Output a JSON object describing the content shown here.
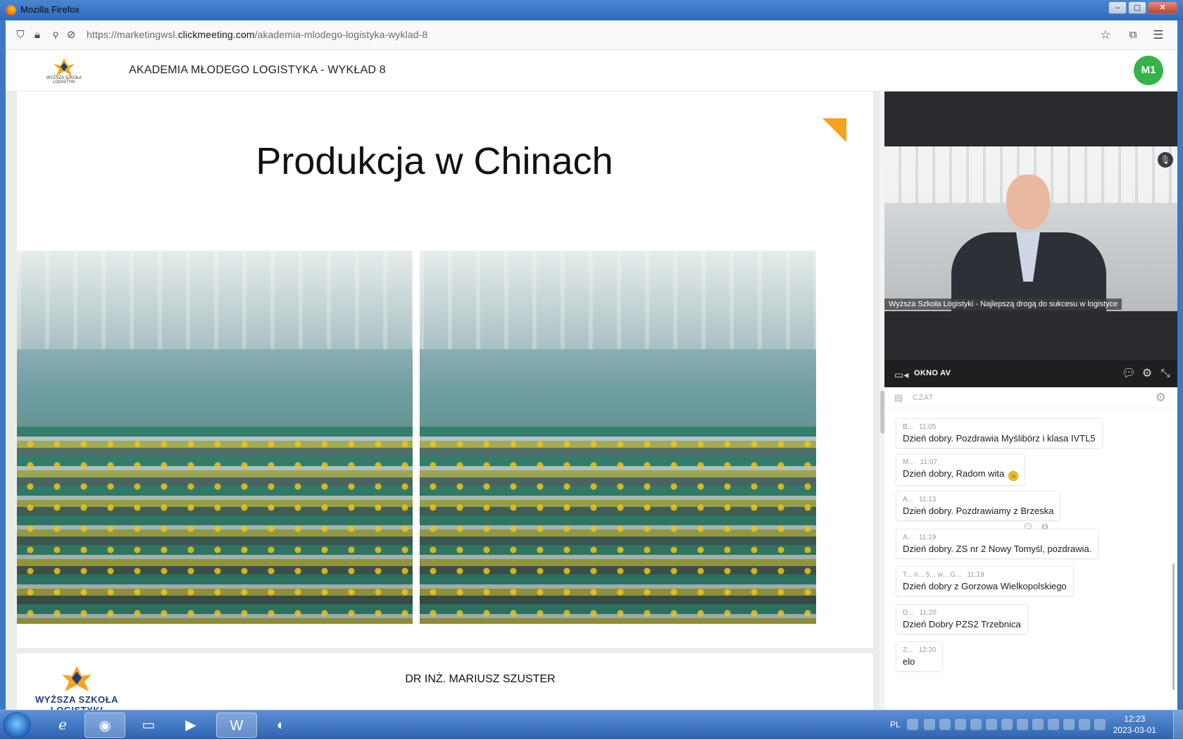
{
  "window": {
    "title": "Mozilla Firefox",
    "controls": [
      "–",
      "▢",
      "✕"
    ]
  },
  "browser": {
    "url_host_prefix": "https://marketingwsl.",
    "url_host_domain": "clickmeeting.com",
    "url_path": "/akademia-mlodego-logistyka-wyklad-8",
    "icons": [
      "shield-icon",
      "lock-icon",
      "permissions-icon",
      "tracking-icon",
      "star-icon",
      "extensions-icon",
      "menu-icon"
    ]
  },
  "header": {
    "logo_text": "WYŻSZA SZKOŁA LOGISTYKI",
    "title": "AKADEMIA MŁODEGO LOGISTYKA - WYKŁAD 8",
    "avatar": "M1"
  },
  "slide": {
    "title": "Produkcja w Chinach",
    "footer_logo_text": "WYŻSZA SZKOŁA LOGISTYKI",
    "author": "DR INŻ. MARIUSZ SZUSTER",
    "accent_color": "#f6a21e"
  },
  "av": {
    "caption": "Wyższa Szkoła Logistyki - Najlepszą drogą do sukcesu w logistyce",
    "label": "OKNO AV"
  },
  "chat": {
    "label": "CZAT",
    "messages": [
      {
        "author": "B...",
        "time": "11:05",
        "text": "Dzień dobry. Pozdrawia Myślibórz i klasa IVTL5"
      },
      {
        "author": "M...",
        "time": "11:07",
        "text": "Dzień dobry, Radom wita"
      },
      {
        "author": "A...",
        "time": "11:13",
        "text": "Dzień dobry. Pozdrawiamy z Brzeska"
      },
      {
        "author": "A...",
        "time": "11:19",
        "text": "Dzień dobry. ZS nr 2 Nowy Tomyśl, pozdrawia."
      },
      {
        "author": "T... n... 5... w... G...",
        "time": "11:19",
        "text": "Dzień dobry z Gorzowa Wielkopolskiego"
      },
      {
        "author": "D...",
        "time": "11:20",
        "text": "Dzień Dobry PZS2 Trzebnica"
      },
      {
        "author": "Z...",
        "time": "12:20",
        "text": "elo"
      }
    ]
  },
  "taskbar": {
    "language": "PL",
    "time": "12:23",
    "date": "2023-03-01"
  }
}
